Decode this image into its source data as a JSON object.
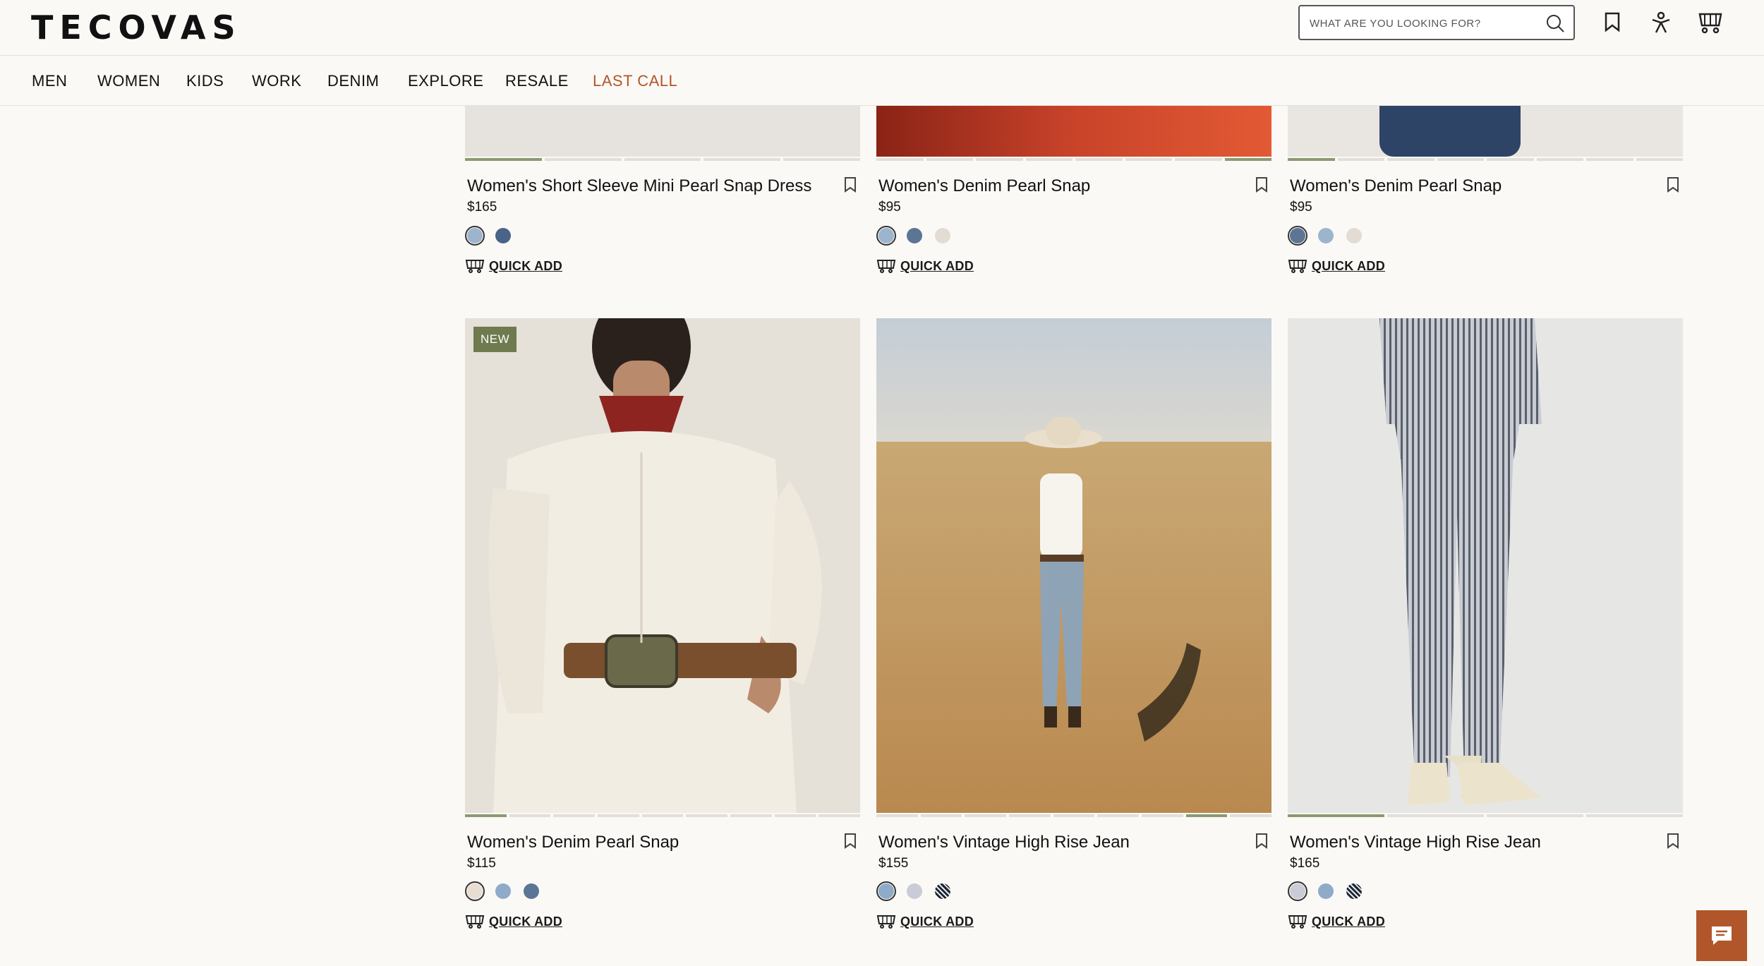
{
  "header": {
    "logo": "TECOVAS",
    "search_placeholder": "WHAT ARE YOU LOOKING FOR?",
    "icons": [
      "search-icon",
      "bookmark-icon",
      "account-icon",
      "cart-icon"
    ]
  },
  "nav": {
    "items": [
      "MEN",
      "WOMEN",
      "KIDS",
      "WORK",
      "DENIM",
      "EXPLORE",
      "RESALE",
      "LAST CALL"
    ],
    "accent_color": "#b0562a"
  },
  "products": [
    {
      "name": "Women's Short Sleeve Mini Pearl Snap Dress",
      "price": "$165",
      "quick_add": "QUICK ADD",
      "swatches": [
        "#9db5cc",
        "#4a6389"
      ]
    },
    {
      "name": "Women's Denim Pearl Snap",
      "price": "$95",
      "quick_add": "QUICK ADD",
      "swatches": [
        "#9db5cc",
        "#5c7594",
        "#e2dcd3"
      ]
    },
    {
      "name": "Women's Denim Pearl Snap",
      "price": "$95",
      "quick_add": "QUICK ADD",
      "swatches": [
        "#5c7594",
        "#9db5cc",
        "#e2dcd3"
      ]
    },
    {
      "name": "Women's Denim Pearl Snap",
      "price": "$115",
      "badge": "NEW",
      "quick_add": "QUICK ADD",
      "swatches": [
        "#e8ddd2",
        "#8fabc9",
        "#5c7594"
      ]
    },
    {
      "name": "Women's Vintage High Rise Jean",
      "price": "$155",
      "quick_add": "QUICK ADD",
      "swatches": [
        "#8fabc9",
        "#c9ccd6",
        "striped-dark"
      ]
    },
    {
      "name": "Women's Vintage High Rise Jean",
      "price": "$165",
      "quick_add": "QUICK ADD",
      "swatches": [
        "#c9ccd6",
        "#8fabc9",
        "striped-dark"
      ]
    }
  ],
  "chat": {
    "icon": "chat-icon"
  }
}
